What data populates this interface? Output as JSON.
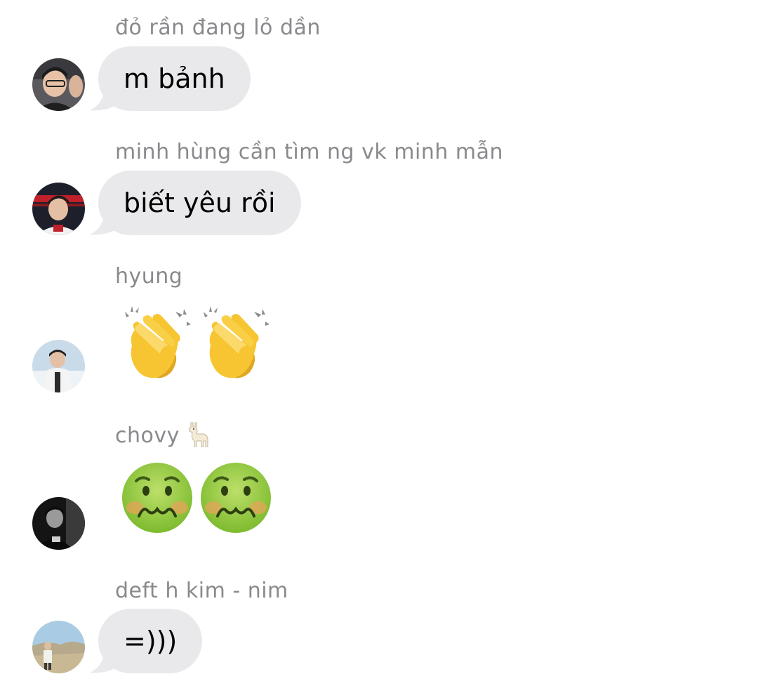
{
  "messages": [
    {
      "sender": "đỏ rần đang lỏ dần",
      "type": "text",
      "text": "m bảnh",
      "avatar": "avatar-photo-1"
    },
    {
      "sender": "minh hùng cần tìm ng vk minh mẫn",
      "type": "text",
      "text": "biết yêu rồi",
      "avatar": "avatar-photo-2"
    },
    {
      "sender": "hyung",
      "type": "emoji",
      "emoji": [
        "clapping-hands-emoji",
        "clapping-hands-emoji"
      ],
      "avatar": "avatar-photo-3"
    },
    {
      "sender": "chovy",
      "sender_emoji": "llama-emoji",
      "type": "emoji",
      "emoji": [
        "nauseated-face-emoji",
        "nauseated-face-emoji"
      ],
      "avatar": "avatar-photo-4"
    },
    {
      "sender": "deft h kim - nim",
      "type": "text",
      "text": "=)))",
      "avatar": "avatar-photo-5"
    }
  ],
  "colors": {
    "bubble": "#e9e9eb",
    "sender_text": "#8a8a8e",
    "message_text": "#000000"
  }
}
